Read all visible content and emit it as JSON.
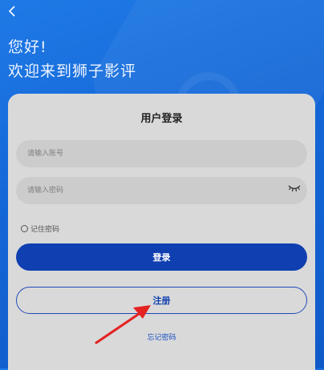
{
  "greeting": {
    "line1": "您好!",
    "line2": "欢迎来到狮子影评"
  },
  "card": {
    "title": "用户登录",
    "account_placeholder": "请输入账号",
    "password_placeholder": "请输入密码",
    "remember_label": "记住密码",
    "login_label": "登录",
    "register_label": "注册",
    "forgot_label": "忘记密码"
  },
  "icons": {
    "back": "chevron-left-icon",
    "password_toggle": "eye-closed-icon",
    "annotation": "red-arrow-icon"
  },
  "colors": {
    "background": "#1466d6",
    "card": "#d9d9d9",
    "primary": "#0f3fb0",
    "annotation": "#e52222"
  }
}
